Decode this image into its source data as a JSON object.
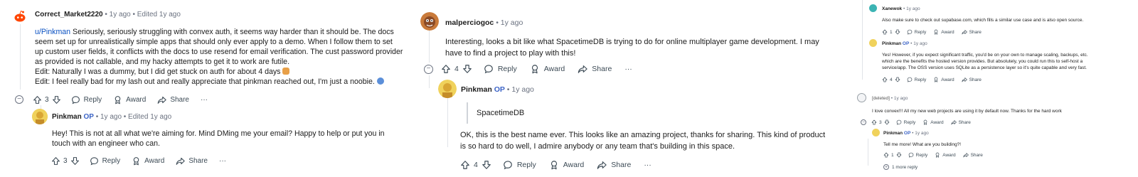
{
  "p1": {
    "c1": {
      "user": "Correct_Market2220",
      "meta": " • 1y ago • Edited 1y ago",
      "mention": "u/Pinkman",
      "l1": " Seriously, seriously struggling with convex auth, it seems way harder than it should be. The docs",
      "l2": "seem set up for unrealistically simple apps that should only ever apply to a demo. When I follow them to set",
      "l3": "up custom user fields, it conflicts with the docs to use resend for email verification. The cust password provider",
      "l4": "as provided is not callable, and my hacky attempts to get it to work are futile.",
      "l5": "Edit: Naturally I was a dummy, but I did get stuck on auth for about 4 days ",
      "l6": "Edit: I feel really bad for my lash out and really appreciate that pinkman reached out, I'm just a noobie. ",
      "votes": "3",
      "reply": "Reply",
      "award": "Award",
      "share": "Share",
      "more": "···"
    },
    "c2": {
      "user": "Pinkman",
      "op": "OP",
      "meta": " • 1y ago • Edited 1y ago",
      "l1": "Hey! This is not at all what we're aiming for. Mind DMing me your email? Happy to help or put you in",
      "l2": "touch with an engineer who can.",
      "votes": "3",
      "reply": "Reply",
      "award": "Award",
      "share": "Share",
      "more": "···"
    }
  },
  "p2": {
    "c1": {
      "user": "malperciogoc",
      "meta": " • 1y ago",
      "l1": "Interesting, looks a bit like what SpacetimeDB is trying to do for online multiplayer game development. I may",
      "l2": "have to find a project to play with this!",
      "votes": "4",
      "reply": "Reply",
      "award": "Award",
      "share": "Share",
      "more": "···"
    },
    "c2": {
      "user": "Pinkman",
      "op": "OP",
      "meta": " • 1y ago",
      "quote": "SpacetimeDB",
      "l1": "OK, this is the best name ever. This looks like an amazing project, thanks for sharing. This kind of product",
      "l2": "is so hard to do well, I admire anybody or any team that's building in this space.",
      "votes": "4",
      "reply": "Reply",
      "award": "Award",
      "share": "Share",
      "more": "···"
    }
  },
  "p3": {
    "c1": {
      "user": "Xanewok",
      "meta": " • 1y ago",
      "l1": "Also make sure to check out supabase.com, which fills a similar use case and is also open source.",
      "votes": "1",
      "reply": "Reply",
      "award": "Award",
      "share": "Share"
    },
    "c2": {
      "user": "Pinkman",
      "op": "OP",
      "meta": " • 1y ago",
      "l1": "Yes! However, if you expect significant traffic, you'd be on your own to manage scaling, backups, etc.",
      "l2": "which are the benefits the hosted version provides. But absolutely, you could run this to self-host a",
      "l3": "service/app. The OSS version uses SQLite as a persistence layer so it's quite capable and very fast.",
      "votes": "4",
      "reply": "Reply",
      "award": "Award",
      "share": "Share"
    },
    "c3": {
      "user": "[deleted]",
      "meta": " • 1y ago",
      "l1": "I love convex!!! All my new web projects are using it by default now. Thanks for the hard work",
      "votes": "3",
      "reply": "Reply",
      "award": "Award",
      "share": "Share"
    },
    "c4": {
      "user": "Pinkman",
      "op": "OP",
      "meta": " • 1y ago",
      "l1": "Tell me more! What are you building?!",
      "votes": "1",
      "reply": "Reply",
      "award": "Award",
      "share": "Share",
      "more_replies": "1 more reply"
    }
  }
}
